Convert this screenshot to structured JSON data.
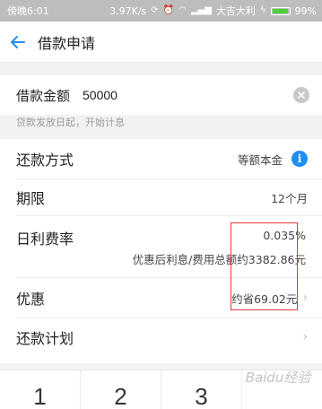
{
  "status_bar": {
    "time": "傍晚6:01",
    "speed": "3.97K/s",
    "carrier": "大吉大利",
    "battery": "99%",
    "battery_level": 0.99
  },
  "nav": {
    "title": "借款申请"
  },
  "amount": {
    "label": "借款金额",
    "value": "50000"
  },
  "hint": "贷款发放日起，开始计息",
  "rows": {
    "repayment_method": {
      "label": "还款方式",
      "value": "等额本金"
    },
    "term": {
      "label": "期限",
      "value": "12个月"
    },
    "daily_rate": {
      "label": "日利费率",
      "value": "0.035%",
      "sub": "优惠后利息/费用总额约3382.86元"
    },
    "discount": {
      "label": "优惠",
      "value": "约省69.02元"
    },
    "plan": {
      "label": "还款计划"
    }
  },
  "keypad": {
    "keys": [
      "1",
      "2",
      "3"
    ]
  },
  "watermark": "Baidu经验",
  "colors": {
    "accent": "#1e8ef0",
    "annotation": "#e53935"
  }
}
